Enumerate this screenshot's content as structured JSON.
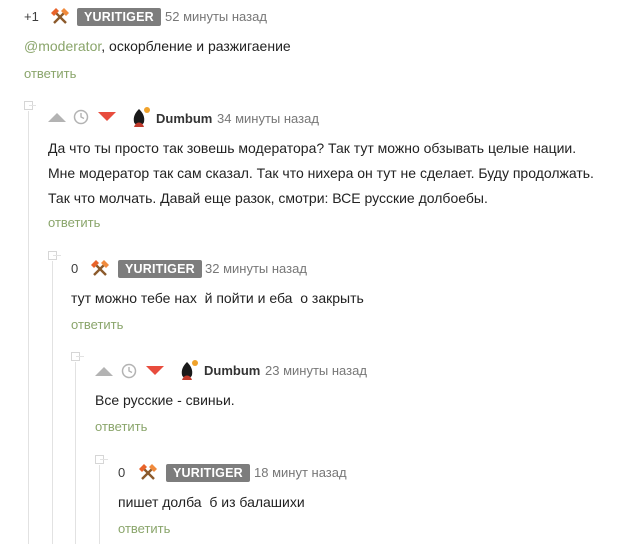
{
  "colors": {
    "accent_green": "#8aa56b",
    "badge_gray": "#7d7d7d",
    "downvote_red": "#e84c3d",
    "online_dot": "#f0a22a"
  },
  "comments": [
    {
      "score": "+1",
      "author": "YURITIGER",
      "time": "52 минуты назад",
      "mention": "@moderator",
      "text": ", оскорбление и разжигаение",
      "reply": "ответить"
    },
    {
      "author": "Dumbum",
      "time": "34 минуты назад",
      "lines": [
        "Да что ты просто так зовешь модератора? Так тут можно обзывать целые нации.",
        "Мне модератор так сам сказал. Так что нихера он тут не сделает. Буду продолжать.",
        "Так что молчать. Давай еще разок, смотри: ВСЕ русские долбоебы."
      ],
      "reply": "ответить"
    },
    {
      "score": "0",
      "author": "YURITIGER",
      "time": "32 минуты назад",
      "text": "тут можно тебе нах  й пойти и еба  о закрыть",
      "reply": "ответить"
    },
    {
      "author": "Dumbum",
      "time": "23 минуты назад",
      "text": "Все русские - свиньи.",
      "reply": "ответить"
    },
    {
      "score": "0",
      "author": "YURITIGER",
      "time": "18 минут назад",
      "text": "пишет долба  б из балашихи",
      "reply": "ответить"
    }
  ]
}
